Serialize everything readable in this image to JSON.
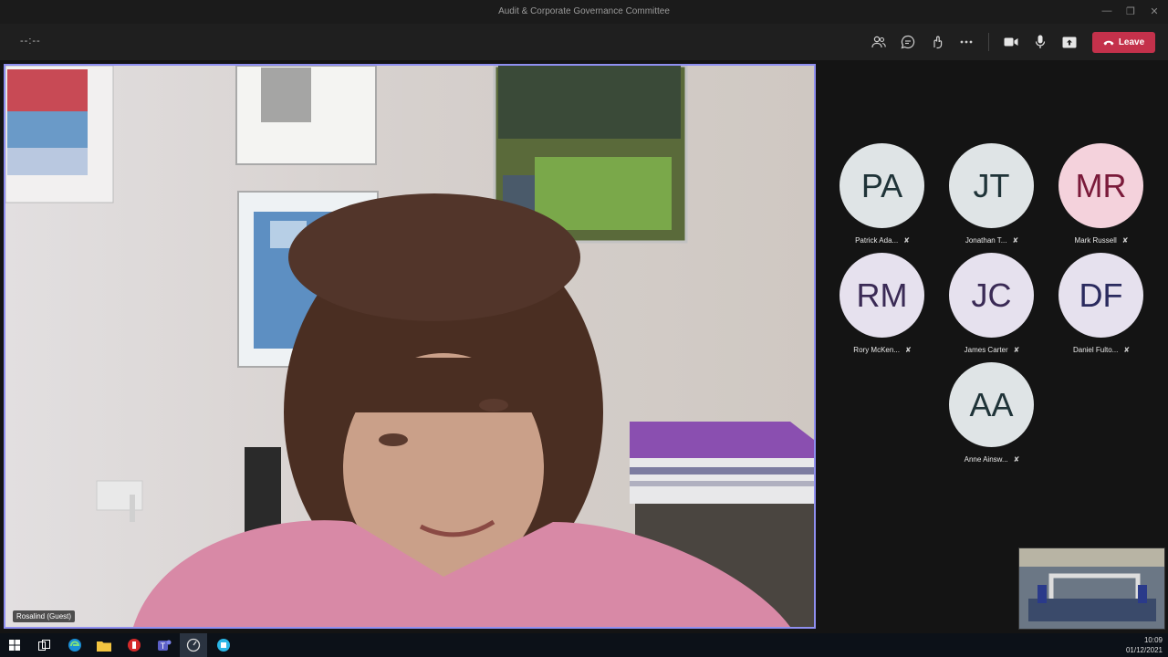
{
  "window": {
    "title": "Audit & Corporate Governance Committee"
  },
  "toolbar": {
    "timer": "--:--",
    "leave_label": "Leave",
    "icons": [
      "people-icon",
      "chat-icon",
      "reactions-icon",
      "more-icon",
      "camera-icon",
      "mic-icon",
      "share-icon"
    ]
  },
  "main_video": {
    "participant_name": "Rosalind (Guest)"
  },
  "participants": [
    {
      "initials": "PA",
      "name": "Patrick Ada...",
      "bg": "#dfe4e6",
      "fg": "#1f3338"
    },
    {
      "initials": "JT",
      "name": "Jonathan T...",
      "bg": "#dfe4e6",
      "fg": "#1f3338"
    },
    {
      "initials": "MR",
      "name": "Mark Russell",
      "bg": "#f4d2dc",
      "fg": "#7a1a3a"
    },
    {
      "initials": "RM",
      "name": "Rory McKen...",
      "bg": "#e6e1ee",
      "fg": "#3a2a55"
    },
    {
      "initials": "JC",
      "name": "James Carter",
      "bg": "#e6e1ee",
      "fg": "#3a2a55"
    },
    {
      "initials": "DF",
      "name": "Daniel Fulto...",
      "bg": "#e6e1ee",
      "fg": "#2a2a5e"
    },
    {
      "initials": "AA",
      "name": "Anne Ainsw...",
      "bg": "#dfe4e6",
      "fg": "#1f3338"
    }
  ],
  "taskbar": {
    "time": "10:09",
    "date": "01/12/2021"
  },
  "colors": {
    "accent": "#8f8ff0",
    "leave": "#c4314b"
  }
}
